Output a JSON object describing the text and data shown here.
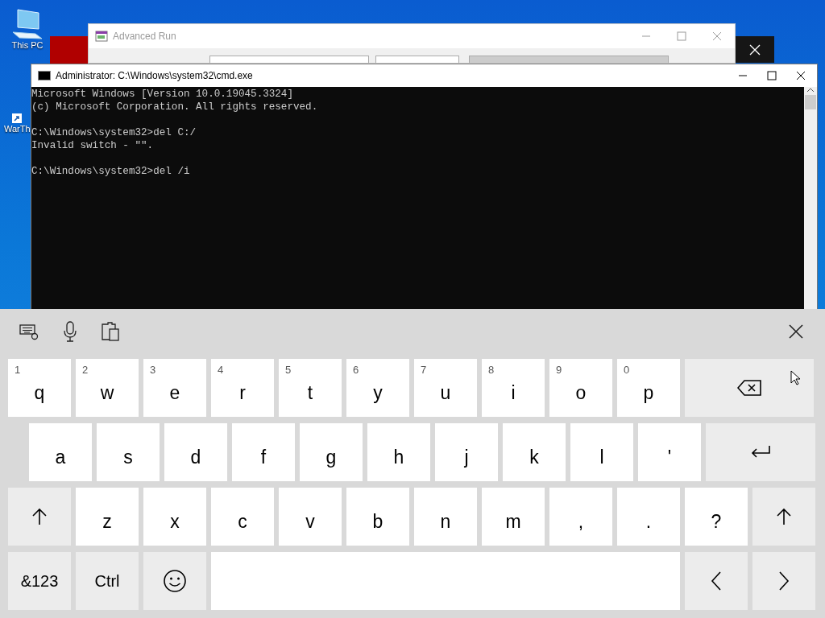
{
  "desktop": {
    "icons": [
      {
        "label": "This PC",
        "kind": "computer"
      },
      {
        "label": "WarTh",
        "kind": "shortcut"
      }
    ]
  },
  "advanced_run": {
    "title": "Advanced Run"
  },
  "cmd_window": {
    "title": "Administrator: C:\\Windows\\system32\\cmd.exe",
    "blocks": [
      [
        "Microsoft Windows [Version 10.0.19045.3324]",
        "(c) Microsoft Corporation. All rights reserved."
      ],
      [
        "C:\\Windows\\system32>del C:/",
        "Invalid switch - \"\"."
      ],
      [
        "C:\\Windows\\system32>del /i"
      ]
    ]
  },
  "keyboard": {
    "rows": [
      [
        {
          "kind": "char",
          "label": "q",
          "hint": "1"
        },
        {
          "kind": "char",
          "label": "w",
          "hint": "2"
        },
        {
          "kind": "char",
          "label": "e",
          "hint": "3"
        },
        {
          "kind": "char",
          "label": "r",
          "hint": "4"
        },
        {
          "kind": "char",
          "label": "t",
          "hint": "5"
        },
        {
          "kind": "char",
          "label": "y",
          "hint": "6"
        },
        {
          "kind": "char",
          "label": "u",
          "hint": "7"
        },
        {
          "kind": "char",
          "label": "i",
          "hint": "8"
        },
        {
          "kind": "char",
          "label": "o",
          "hint": "9"
        },
        {
          "kind": "char",
          "label": "p",
          "hint": "0"
        },
        {
          "kind": "backspace"
        }
      ],
      [
        {
          "kind": "char",
          "label": "a"
        },
        {
          "kind": "char",
          "label": "s"
        },
        {
          "kind": "char",
          "label": "d"
        },
        {
          "kind": "char",
          "label": "f"
        },
        {
          "kind": "char",
          "label": "g"
        },
        {
          "kind": "char",
          "label": "h"
        },
        {
          "kind": "char",
          "label": "j"
        },
        {
          "kind": "char",
          "label": "k"
        },
        {
          "kind": "char",
          "label": "l"
        },
        {
          "kind": "char",
          "label": "'"
        },
        {
          "kind": "enter"
        }
      ],
      [
        {
          "kind": "shift"
        },
        {
          "kind": "char",
          "label": "z"
        },
        {
          "kind": "char",
          "label": "x"
        },
        {
          "kind": "char",
          "label": "c"
        },
        {
          "kind": "char",
          "label": "v"
        },
        {
          "kind": "char",
          "label": "b"
        },
        {
          "kind": "char",
          "label": "n"
        },
        {
          "kind": "char",
          "label": "m"
        },
        {
          "kind": "char",
          "label": ","
        },
        {
          "kind": "char",
          "label": "."
        },
        {
          "kind": "char",
          "label": "?"
        },
        {
          "kind": "shift"
        }
      ],
      [
        {
          "kind": "text",
          "label": "&123"
        },
        {
          "kind": "text",
          "label": "Ctrl"
        },
        {
          "kind": "emoji"
        },
        {
          "kind": "space"
        },
        {
          "kind": "left"
        },
        {
          "kind": "right"
        }
      ]
    ]
  }
}
